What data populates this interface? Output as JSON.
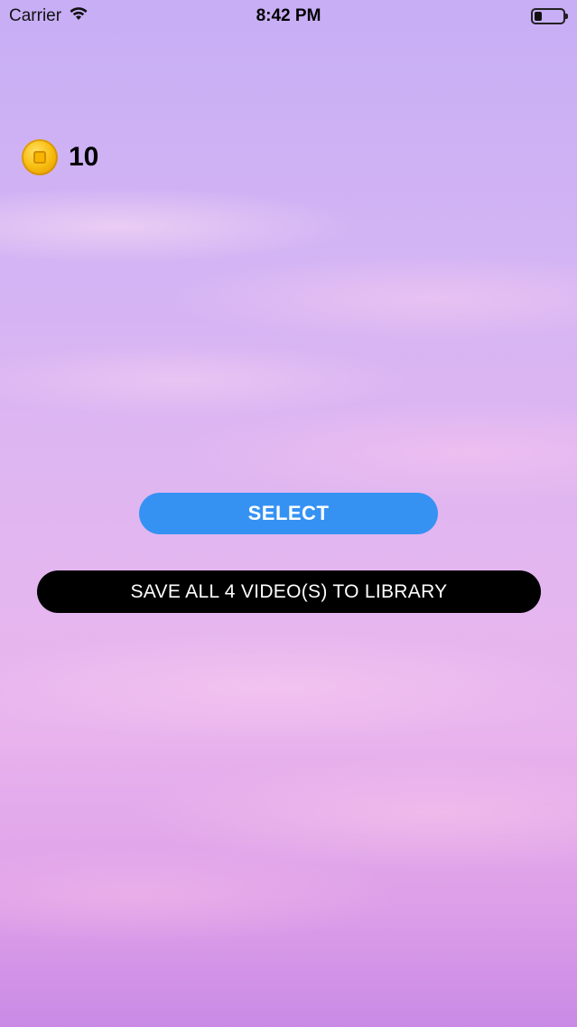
{
  "status_bar": {
    "carrier": "Carrier",
    "time": "8:42 PM",
    "wifi_icon": "wifi-icon",
    "battery_icon": "battery-icon",
    "battery_level": 0.25
  },
  "coins": {
    "icon": "coin-icon",
    "count": "10"
  },
  "actions": {
    "select_label": "SELECT",
    "save_label": "SAVE ALL 4 VIDEO(S) TO LIBRARY"
  },
  "colors": {
    "select_button": "#3592f3",
    "save_button": "#000000",
    "coin": "#f9c013"
  }
}
